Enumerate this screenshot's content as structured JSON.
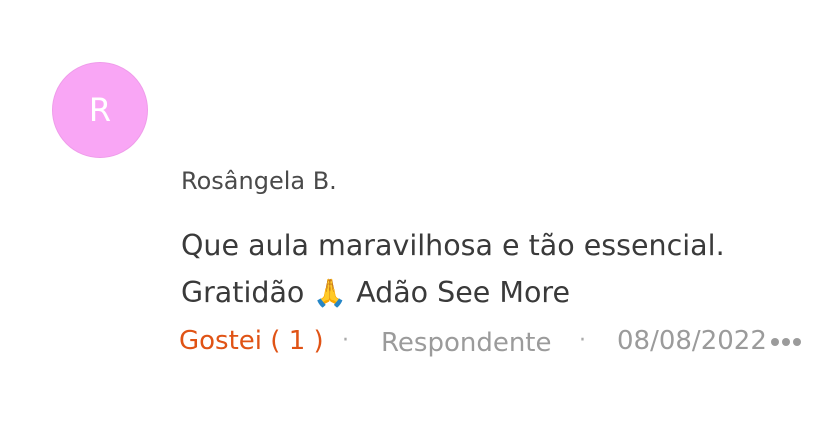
{
  "comment": {
    "avatar_initial": "R",
    "avatar_color": "#f9a6f5",
    "author": "Rosângela B.",
    "text_before_emoji": "Que aula maravilhosa e tão essencial. Gratidão ",
    "emoji": "🙏",
    "emoji_name": "folded-hands-icon",
    "text_after_emoji": " Adão ",
    "see_more_label": "See More",
    "like_label": "Gostei ( 1 )",
    "separator": "·",
    "reply_label": "Respondente",
    "date": "08/08/2022",
    "more_icon": "more-options-icon",
    "accent_color": "#e05315"
  }
}
